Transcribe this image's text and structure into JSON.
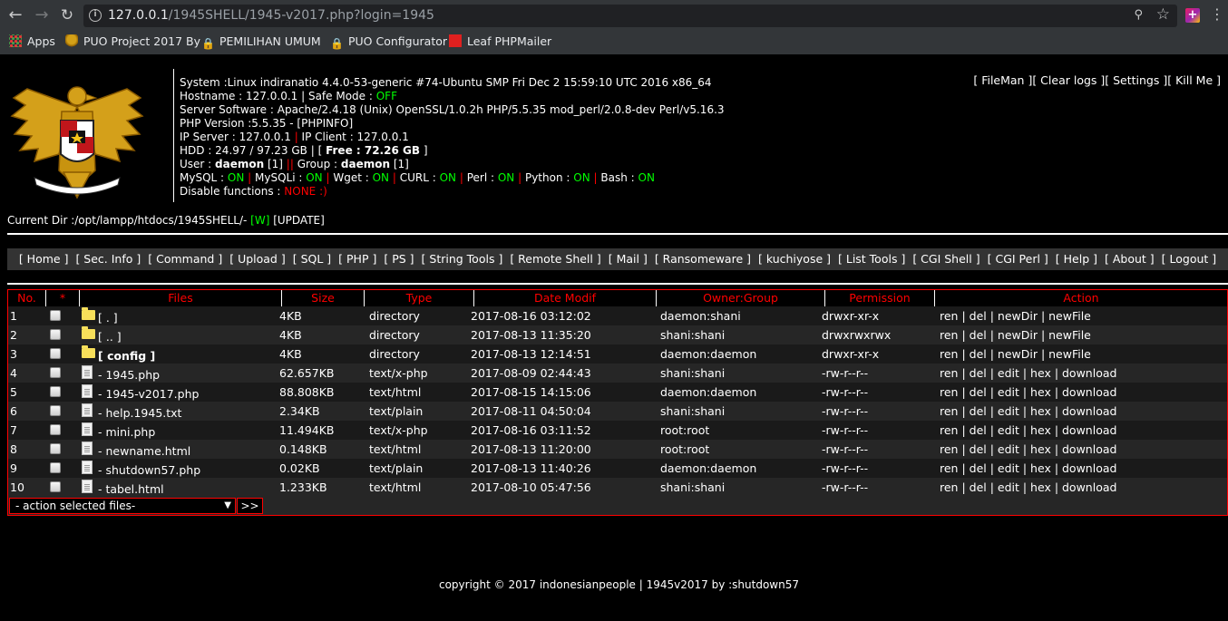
{
  "browser": {
    "url_host": "127.0.0.1",
    "url_path": "/1945SHELL/1945-v2017.php?login=1945",
    "bookmarks": [
      {
        "label": "Apps"
      },
      {
        "label": "PUO Project 2017 By"
      },
      {
        "label": "PEMILIHAN UMUM"
      },
      {
        "label": "PUO Configurator"
      },
      {
        "label": "Leaf PHPMailer"
      }
    ]
  },
  "sysinfo": {
    "system": "System :Linux indiranatio 4.4.0-53-generic #74-Ubuntu SMP Fri Dec 2 15:59:10 UTC 2016 x86_64",
    "hostname_label": "Hostname : 127.0.0.1 | Safe Mode : ",
    "safe_mode": "OFF",
    "server_software": "Server Software : Apache/2.4.18 (Unix) OpenSSL/1.0.2h PHP/5.5.35 mod_perl/2.0.8-dev Perl/v5.16.3",
    "php_version": "PHP Version :5.5.35 - [PHPINFO]",
    "ip_server_label": "IP Server : 127.0.0.1 ",
    "sep": "|",
    "ip_client_label": " IP Client : 127.0.0.1",
    "hdd_label": "HDD : 24.97 / 97.23 GB | [ ",
    "free_label": "Free : 72.26 GB",
    "hdd_end": " ]",
    "user_label": "User : ",
    "user": "daemon",
    "user_id": " [1] ",
    "group_label": " Group : ",
    "group": "daemon",
    "group_id": " [1]",
    "modules": [
      {
        "name": "MySQL : ",
        "status": "ON"
      },
      {
        "name": "MySQLi : ",
        "status": "ON"
      },
      {
        "name": "Wget : ",
        "status": "ON"
      },
      {
        "name": "CURL : ",
        "status": "ON"
      },
      {
        "name": "Perl : ",
        "status": "ON"
      },
      {
        "name": "Python : ",
        "status": "ON"
      },
      {
        "name": "Bash : ",
        "status": "ON"
      }
    ],
    "disable_label": "Disable functions : ",
    "disable_value": "NONE :)"
  },
  "topmenu": "[ FileMan ][ Clear logs ][ Settings ][ Kill Me ]",
  "curdir": {
    "label": "Current Dir :/opt/lampp/htdocs/1945SHELL/- ",
    "w": "[W]",
    "update": " [UPDATE]"
  },
  "nav": [
    "[ Home ]",
    "[ Sec. Info ]",
    "[ Command ]",
    "[ Upload ]",
    "[ SQL ]",
    "[ PHP ]",
    "[ PS ]",
    "[ String Tools ]",
    "[ Remote Shell ]",
    "[ Mail ]",
    "[ Ransomeware ]",
    "[ kuchiyose ]",
    "[ List Tools ]",
    "[ CGI Shell ]",
    "[ CGI Perl ]",
    "[ Help ]",
    "[ About ]",
    "[ Logout ]"
  ],
  "table": {
    "headers": {
      "no": "No.",
      "star": "*",
      "files": "Files",
      "size": "Size",
      "type": "Type",
      "date": "Date Modif",
      "owner": "Owner:Group",
      "perm": "Permission",
      "action": "Action"
    },
    "rows": [
      {
        "no": "1",
        "kind": "dir",
        "name": "[ . ]",
        "size": "4KB",
        "type": "directory",
        "date": "2017-08-16 03:12:02",
        "owner": "daemon:shani",
        "perm": "drwxr-xr-x",
        "action": "ren | del | newDir | newFile"
      },
      {
        "no": "2",
        "kind": "dir",
        "name": "[ .. ]",
        "size": "4KB",
        "type": "directory",
        "date": "2017-08-13 11:35:20",
        "owner": "shani:shani",
        "perm": "drwxrwxrwx",
        "action": "ren | del | newDir | newFile"
      },
      {
        "no": "3",
        "kind": "dir",
        "name": "[ config ]",
        "size": "4KB",
        "type": "directory",
        "date": "2017-08-13 12:14:51",
        "owner": "daemon:daemon",
        "perm": "drwxr-xr-x",
        "action": "ren | del | newDir | newFile"
      },
      {
        "no": "4",
        "kind": "file",
        "name": "- 1945.php",
        "size": "62.657KB",
        "type": "text/x-php",
        "date": "2017-08-09 02:44:43",
        "owner": "shani:shani",
        "perm": "-rw-r--r--",
        "action": "ren | del | edit | hex | download"
      },
      {
        "no": "5",
        "kind": "file",
        "name": "- 1945-v2017.php",
        "size": "88.808KB",
        "type": "text/html",
        "date": "2017-08-15 14:15:06",
        "owner": "daemon:daemon",
        "perm": "-rw-r--r--",
        "action": "ren | del | edit | hex | download"
      },
      {
        "no": "6",
        "kind": "file",
        "name": "- help.1945.txt",
        "size": "2.34KB",
        "type": "text/plain",
        "date": "2017-08-11 04:50:04",
        "owner": "shani:shani",
        "perm": "-rw-r--r--",
        "action": "ren | del | edit | hex | download"
      },
      {
        "no": "7",
        "kind": "file",
        "name": "- mini.php",
        "size": "11.494KB",
        "type": "text/x-php",
        "date": "2017-08-16 03:11:52",
        "owner": "root:root",
        "perm": "-rw-r--r--",
        "action": "ren | del | edit | hex | download"
      },
      {
        "no": "8",
        "kind": "file",
        "name": "- newname.html",
        "size": "0.148KB",
        "type": "text/html",
        "date": "2017-08-13 11:20:00",
        "owner": "root:root",
        "perm": "-rw-r--r--",
        "action": "ren | del | edit | hex | download"
      },
      {
        "no": "9",
        "kind": "file",
        "name": "- shutdown57.php",
        "size": "0.02KB",
        "type": "text/plain",
        "date": "2017-08-13 11:40:26",
        "owner": "daemon:daemon",
        "perm": "-rw-r--r--",
        "action": "ren | del | edit | hex | download"
      },
      {
        "no": "10",
        "kind": "file",
        "name": "- tabel.html",
        "size": "1.233KB",
        "type": "text/html",
        "date": "2017-08-10 05:47:56",
        "owner": "shani:shani",
        "perm": "-rw-r--r--",
        "action": "ren | del | edit | hex | download"
      }
    ],
    "action_select": "- action selected files-",
    "action_go": ">>"
  },
  "footer": "copyright © 2017 indonesianpeople | 1945v2017 by :shutdown57",
  "colors": {
    "accent_red": "#ff0000",
    "status_green": "#00ff00",
    "background": "#000000"
  }
}
